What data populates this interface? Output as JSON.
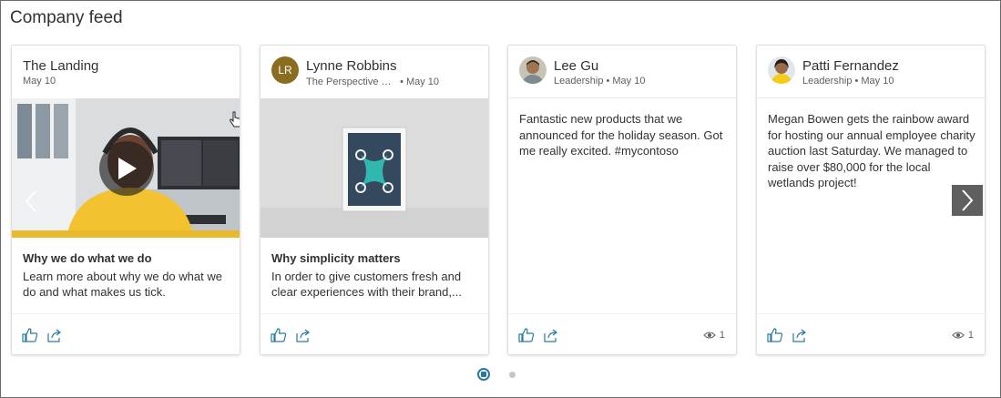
{
  "feed": {
    "title": "Company feed"
  },
  "cards": [
    {
      "title": "The Landing",
      "date": "May 10",
      "summary_title": "Why we do what we do",
      "summary_body": "Learn more about why we do what we do and what makes us tick."
    },
    {
      "title": "Lynne Robbins",
      "avatar_initials": "LR",
      "source": "The Perspective ★ Followi...",
      "date": "• May 10",
      "summary_title": "Why simplicity matters",
      "summary_body": "In order to give customers fresh and clear experiences with their brand,..."
    },
    {
      "title": "Lee Gu",
      "subtitle": "Leadership • May 10",
      "text": "Fantastic new products that we announced for the holiday season. Got me really excited. #mycontoso",
      "views": "1"
    },
    {
      "title": "Patti Fernandez",
      "subtitle": "Leadership • May 10",
      "text": "Megan Bowen gets the rainbow award for hosting our annual employee charity auction last Saturday. We managed to raise over $80,000 for the local wetlands project!",
      "views": "1"
    }
  ],
  "colors": {
    "accent": "#2b7a9e",
    "avatar_lr": "#8a6d1e",
    "next_arrow_bg": "#5f5f5f"
  },
  "icons": [
    "like-icon",
    "share-icon",
    "eye-icon",
    "play-icon",
    "chevron-left-icon",
    "chevron-right-icon",
    "cursor-hand-icon"
  ]
}
